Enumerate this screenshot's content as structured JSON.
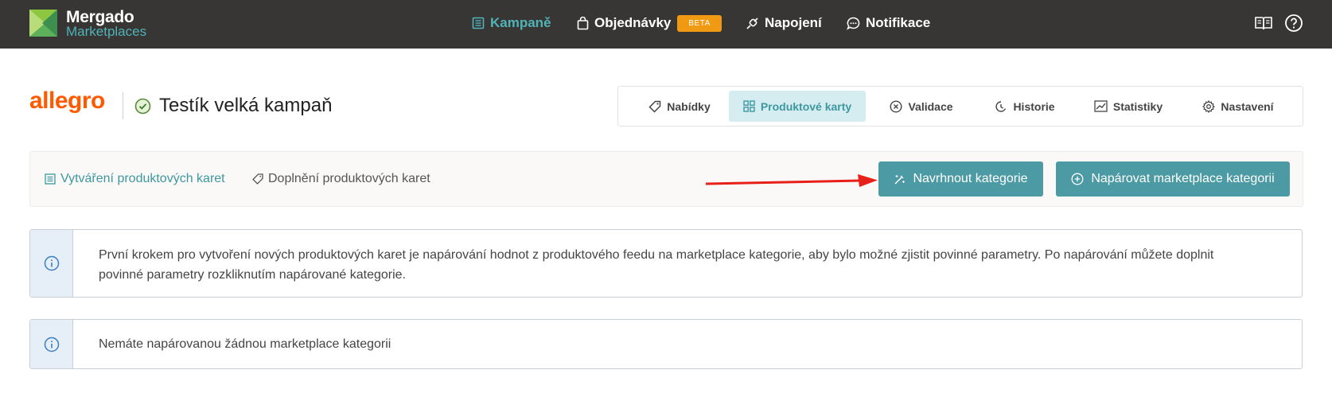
{
  "app": {
    "name": "Mergado",
    "subname": "Marketplaces"
  },
  "nav": {
    "campaigns": "Kampaně",
    "orders": "Objednávky",
    "orders_badge": "BETA",
    "connections": "Napojení",
    "notifications": "Notifikace"
  },
  "top_icons": [
    "book-icon",
    "help-icon"
  ],
  "header": {
    "brand": "allegro",
    "campaign_title": "Testík velká kampaň",
    "campaign_status_icon": "check-circle-icon"
  },
  "tabs": [
    {
      "label": "Nabídky",
      "icon": "tag-icon"
    },
    {
      "label": "Produktové karty",
      "icon": "grid-icon"
    },
    {
      "label": "Validace",
      "icon": "x-circle-icon"
    },
    {
      "label": "Historie",
      "icon": "history-icon"
    },
    {
      "label": "Statistiky",
      "icon": "chart-icon"
    },
    {
      "label": "Nastavení",
      "icon": "gear-icon"
    }
  ],
  "active_tab": "Produktové karty",
  "subnav": {
    "create_cards": "Vytváření produktových karet",
    "complete_cards": "Doplnění produktových karet"
  },
  "actions": {
    "suggest_categories": "Navrhnout kategorie",
    "pair_categories": "Napárovat marketplace kategorii"
  },
  "info": {
    "intro_line1": "První krokem pro vytvoření nových produktových karet je napárování hodnot z produktového feedu na marketplace kategorie, aby bylo možné zjistit povinné parametry. Po napárování můžete doplnit",
    "intro_line2": "povinné parametry rozkliknutím napárované kategorie.",
    "empty": "Nemáte napárovanou žádnou marketplace kategorii"
  },
  "colors": {
    "topbar": "#383634",
    "accent": "#4c9aa3",
    "accent_text": "#3d98a1",
    "brand": "#ff5a00",
    "beta_badge": "#ef9a12",
    "annotation_arrow": "#e8201a"
  }
}
